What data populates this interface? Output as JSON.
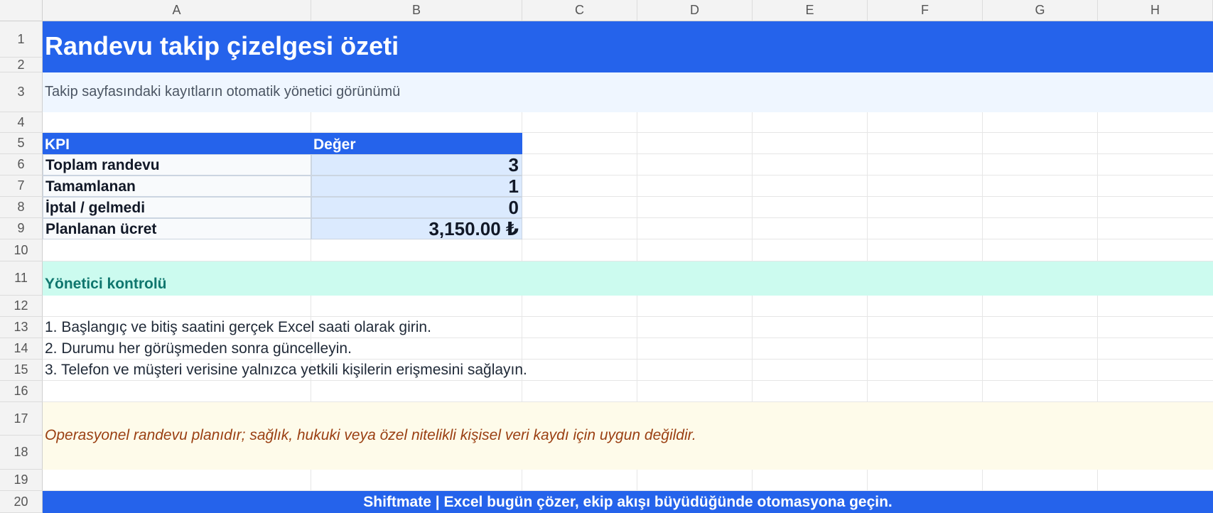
{
  "sheet": {
    "columns": [
      "A",
      "B",
      "C",
      "D",
      "E",
      "F",
      "G",
      "H"
    ],
    "rows": [
      "1",
      "2",
      "3",
      "4",
      "5",
      "6",
      "7",
      "8",
      "9",
      "10",
      "11",
      "12",
      "13",
      "14",
      "15",
      "16",
      "17",
      "18",
      "19",
      "20"
    ]
  },
  "title": "Randevu takip çizelgesi özeti",
  "subtitle": "Takip sayfasındaki kayıtların otomatik yönetici görünümü",
  "kpi_table": {
    "headers": {
      "kpi": "KPI",
      "value": "Değer"
    },
    "rows": [
      {
        "label": "Toplam randevu",
        "value": "3"
      },
      {
        "label": "Tamamlanan",
        "value": "1"
      },
      {
        "label": "İptal / gelmedi",
        "value": "0"
      },
      {
        "label": "Planlanan ücret",
        "value": "3,150.00 ₺"
      }
    ]
  },
  "manager_section": {
    "title": "Yönetici kontrolü",
    "steps": [
      "1. Başlangıç ve bitiş saatini gerçek Excel saati olarak girin.",
      "2. Durumu her görüşmeden sonra güncelleyin.",
      "3. Telefon ve müşteri verisine yalnızca yetkili kişilerin erişmesini sağlayın."
    ]
  },
  "disclaimer": "Operasyonel randevu planıdır; sağlık, hukuki veya özel nitelikli kişisel veri kaydı için uygun değildir.",
  "footer": "Shiftmate | Excel bugün çözer, ekip akışı büyüdüğünde otomasyona geçin.",
  "colors": {
    "accent_blue": "#2563eb",
    "subtitle_bg": "#eff6ff",
    "section_bg": "#ccfbef",
    "section_text": "#0f766e",
    "note_bg": "#fefbea",
    "note_text": "#9a3f12",
    "value_bg": "#dbeafe"
  }
}
